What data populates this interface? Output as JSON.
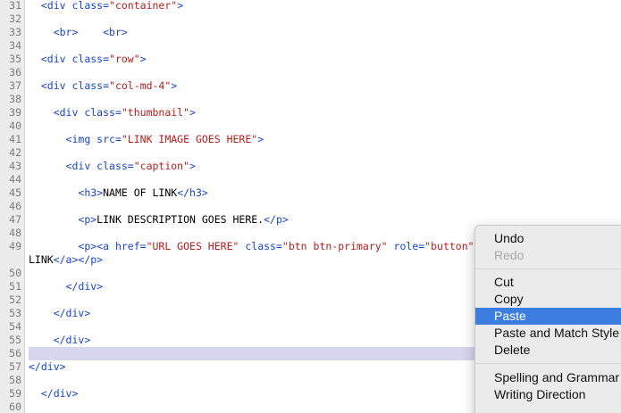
{
  "editor": {
    "lines": [
      {
        "num": "31",
        "segments": [
          {
            "t": "  "
          },
          {
            "c": "tag",
            "t": "<div "
          },
          {
            "c": "attr",
            "t": "class="
          },
          {
            "c": "str",
            "t": "\"container\""
          },
          {
            "c": "tag",
            "t": ">"
          }
        ]
      },
      {
        "num": "32",
        "segments": []
      },
      {
        "num": "33",
        "segments": [
          {
            "t": "    "
          },
          {
            "c": "tag",
            "t": "<br>"
          },
          {
            "t": "    "
          },
          {
            "c": "tag",
            "t": "<br>"
          }
        ]
      },
      {
        "num": "34",
        "segments": []
      },
      {
        "num": "35",
        "segments": [
          {
            "t": "  "
          },
          {
            "c": "tag",
            "t": "<div "
          },
          {
            "c": "attr",
            "t": "class="
          },
          {
            "c": "str",
            "t": "\"row\""
          },
          {
            "c": "tag",
            "t": ">"
          }
        ]
      },
      {
        "num": "36",
        "segments": []
      },
      {
        "num": "37",
        "segments": [
          {
            "t": "  "
          },
          {
            "c": "tag",
            "t": "<div "
          },
          {
            "c": "attr",
            "t": "class="
          },
          {
            "c": "str",
            "t": "\"col-md-4\""
          },
          {
            "c": "tag",
            "t": ">"
          }
        ]
      },
      {
        "num": "38",
        "segments": []
      },
      {
        "num": "39",
        "segments": [
          {
            "t": "    "
          },
          {
            "c": "tag",
            "t": "<div "
          },
          {
            "c": "attr",
            "t": "class="
          },
          {
            "c": "str",
            "t": "\"thumbnail\""
          },
          {
            "c": "tag",
            "t": ">"
          }
        ]
      },
      {
        "num": "40",
        "segments": []
      },
      {
        "num": "41",
        "segments": [
          {
            "t": "      "
          },
          {
            "c": "tag",
            "t": "<img "
          },
          {
            "c": "attr",
            "t": "src="
          },
          {
            "c": "str",
            "t": "\"LINK IMAGE GOES HERE\""
          },
          {
            "c": "tag",
            "t": ">"
          }
        ]
      },
      {
        "num": "42",
        "segments": []
      },
      {
        "num": "43",
        "segments": [
          {
            "t": "      "
          },
          {
            "c": "tag",
            "t": "<div "
          },
          {
            "c": "attr",
            "t": "class="
          },
          {
            "c": "str",
            "t": "\"caption\""
          },
          {
            "c": "tag",
            "t": ">"
          }
        ]
      },
      {
        "num": "44",
        "segments": []
      },
      {
        "num": "45",
        "segments": [
          {
            "t": "        "
          },
          {
            "c": "tag",
            "t": "<h3>"
          },
          {
            "c": "txt",
            "t": "NAME OF LINK"
          },
          {
            "c": "tag",
            "t": "</h3>"
          }
        ]
      },
      {
        "num": "46",
        "segments": []
      },
      {
        "num": "47",
        "segments": [
          {
            "t": "        "
          },
          {
            "c": "tag",
            "t": "<p>"
          },
          {
            "c": "txt",
            "t": "LINK DESCRIPTION GOES HERE."
          },
          {
            "c": "tag",
            "t": "</p>"
          }
        ]
      },
      {
        "num": "48",
        "segments": []
      },
      {
        "num": "49",
        "segments": [
          {
            "t": "        "
          },
          {
            "c": "tag",
            "t": "<p><a "
          },
          {
            "c": "attr",
            "t": "href="
          },
          {
            "c": "str",
            "t": "\"URL GOES HERE\""
          },
          {
            "t": " "
          },
          {
            "c": "attr",
            "t": "class="
          },
          {
            "c": "str",
            "t": "\"btn btn-primary\""
          },
          {
            "t": " "
          },
          {
            "c": "attr",
            "t": "role="
          },
          {
            "c": "str",
            "t": "\"button\""
          }
        ]
      },
      {
        "num": "",
        "segments": [
          {
            "c": "txt",
            "t": "LINK"
          },
          {
            "c": "tag",
            "t": "</a></p>"
          }
        ]
      },
      {
        "num": "50",
        "segments": []
      },
      {
        "num": "51",
        "segments": [
          {
            "t": "      "
          },
          {
            "c": "tag",
            "t": "</div>"
          }
        ]
      },
      {
        "num": "52",
        "segments": []
      },
      {
        "num": "53",
        "segments": [
          {
            "t": "    "
          },
          {
            "c": "tag",
            "t": "</div>"
          }
        ]
      },
      {
        "num": "54",
        "segments": []
      },
      {
        "num": "55",
        "segments": [
          {
            "t": "    "
          },
          {
            "c": "tag",
            "t": "</div>"
          }
        ]
      },
      {
        "num": "56",
        "active": true,
        "segments": []
      },
      {
        "num": "57",
        "segments": [
          {
            "c": "tag",
            "t": "</div>"
          }
        ]
      },
      {
        "num": "58",
        "segments": []
      },
      {
        "num": "59",
        "segments": [
          {
            "t": "  "
          },
          {
            "c": "tag",
            "t": "</div>"
          }
        ]
      },
      {
        "num": "60",
        "segments": []
      }
    ]
  },
  "context_menu": {
    "undo": "Undo",
    "redo": "Redo",
    "cut": "Cut",
    "copy": "Copy",
    "paste": "Paste",
    "paste_match": "Paste and Match Style",
    "delete": "Delete",
    "spelling": "Spelling and Grammar",
    "writing_direction": "Writing Direction"
  },
  "colors": {
    "tag": "#1a45c8",
    "string": "#b41e1e",
    "active_line": "#d6d6ee",
    "menu_highlight": "#3b7ee0"
  }
}
